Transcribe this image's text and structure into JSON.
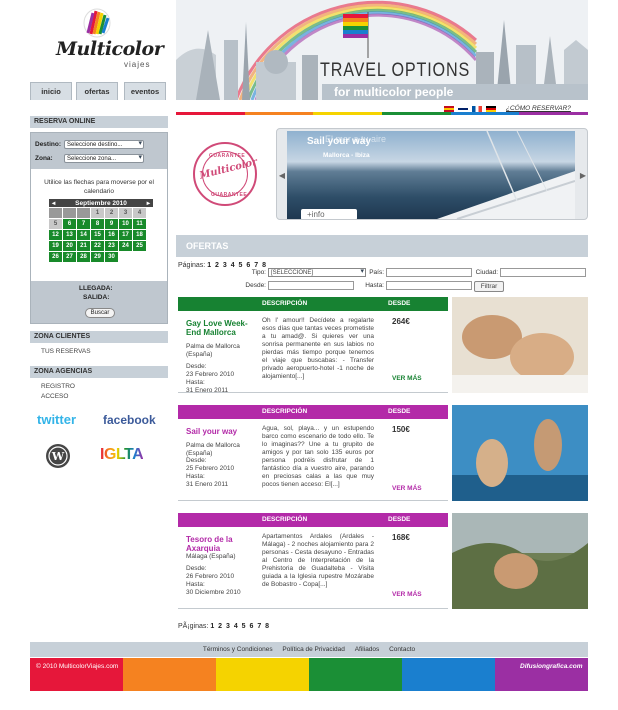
{
  "brand": {
    "name": "Multicolor",
    "sub": "viajes"
  },
  "nav": {
    "tabs": [
      {
        "label": "inicio"
      },
      {
        "label": "ofertas"
      },
      {
        "label": "eventos"
      }
    ]
  },
  "banner": {
    "title": "TRAVEL OPTIONS",
    "subtitle": "for multicolor people"
  },
  "languages": [
    "es-flag-icon",
    "uk-flag-icon",
    "fr-flag-icon",
    "de-flag-icon"
  ],
  "como_reservar": "¿CÓMO RESERVAR?",
  "reserva": {
    "title": "RESERVA ONLINE",
    "destino_label": "Destino:",
    "destino_value": "Seleccione destino...",
    "zona_label": "Zona:",
    "zona_value": "Seleccione zona...",
    "note": "Utilice las flechas para moverse por el calendario",
    "month": "Septiembre 2010",
    "llegada": "LLEGADA:",
    "salida": "SALIDA:",
    "buscar": "Buscar"
  },
  "calendar": {
    "blanks": 3,
    "past": [
      "1",
      "2",
      "3",
      "4",
      "5"
    ],
    "available": [
      "6",
      "7",
      "8",
      "9",
      "10",
      "11",
      "12",
      "13",
      "14",
      "15",
      "16",
      "17",
      "18",
      "19",
      "20",
      "21",
      "22",
      "23",
      "24",
      "25",
      "26",
      "27",
      "28",
      "29",
      "30"
    ]
  },
  "zona_clientes": {
    "title": "ZONA CLIENTES",
    "link": "TUS RESERVAS"
  },
  "zona_agencias": {
    "title": "ZONA AGENCIAS",
    "registro": "REGISTRO",
    "acceso": "ACCESO"
  },
  "social": {
    "twitter": "twitter",
    "facebook": "facebook",
    "iglta": "IGLTA"
  },
  "slider": {
    "title": "Sail your way",
    "ghost": "El mar a tu aire",
    "sub": "Mallorca - Ibiza",
    "info": "+info"
  },
  "stamp": {
    "top": "GUARANTEE",
    "main": "Multicolor",
    "bottom": "GUARANTEE"
  },
  "ofertas": {
    "title": "OFERTAS",
    "pag_label_top": "Páginas:",
    "pag_label_bottom": "PÃ¡ginas:",
    "pages": "1 2 3 4 5 6 7 8",
    "tipo_label": "Tipo:",
    "tipo_value": "[SELECCIONE]",
    "pais_label": "País:",
    "ciudad_label": "Ciudad:",
    "desde_label": "Desde:",
    "hasta_label": "Hasta:",
    "filtrar": "Filtrar",
    "col_desc": "DESCRIPCIÓN",
    "col_desde": "DESDE",
    "ver_mas": "VER MÁS"
  },
  "offers": [
    {
      "name": "Gay Love Week-End Mallorca",
      "location": "Palma de Mallorca (España)",
      "desde_label": "Desde:",
      "desde": "23 Febrero 2010",
      "hasta_label": "Hasta:",
      "hasta": "31 Enero 2011",
      "description": "Oh l' amour!! Decídete a regalarte esos días que tantas veces prometiste a tu amad@. Si quieres ver una sonrisa permanente en sus labios no pierdas más tiempo porque tenemos el viaje que buscabas: - Transfer privado aeropuerto-hotel -1 noche de alojamiento[...]",
      "price": "264€",
      "color": "#178232"
    },
    {
      "name": "Sail your way",
      "location": "Palma de Mallorca (España)",
      "desde_label": "Desde:",
      "desde": "25 Febrero 2010",
      "hasta_label": "Hasta:",
      "hasta": "31 Enero 2011",
      "description": "Agua, sol, playa... y un estupendo barco como escenario de todo ello. Te lo imaginas?? Une a tu grupito de amigos y por tan solo 135 euros por persona podréis disfrutar de 1 fantástico día a vuestro aire, parando en preciosas calas a las que muy pocos tienen acceso: El[...]",
      "price": "150€",
      "color": "#b32aa8"
    },
    {
      "name": "Tesoro de la Axarquia",
      "location": "Málaga (España)",
      "desde_label": "Desde:",
      "desde": "26 Febrero 2010",
      "hasta_label": "Hasta:",
      "hasta": "30 Diciembre 2010",
      "description": "Apartamentos Ardales (Ardales - Málaga) - 2 noches alojamiento para 2 personas - Cesta desayuno - Entradas al Centro de Interpretación de la Prehistoria de Guadalteba - Visita guiada a la Iglesia rupestre Mozárabe de Bobastro - Copa[...]",
      "price": "168€",
      "color": "#b32aa8"
    }
  ],
  "footer": {
    "links": [
      "Términos y Condiciones",
      "Política de Privacidad",
      "Afiliados",
      "Contacto"
    ],
    "copyright": "© 2010 MulticolorViajes.com",
    "credit": "Difusiongrafica.com"
  },
  "colors": {
    "rainbow": [
      "#e6173a",
      "#f58220",
      "#f5d300",
      "#1b8f36",
      "#1a7fcf",
      "#9b2fa3"
    ]
  }
}
